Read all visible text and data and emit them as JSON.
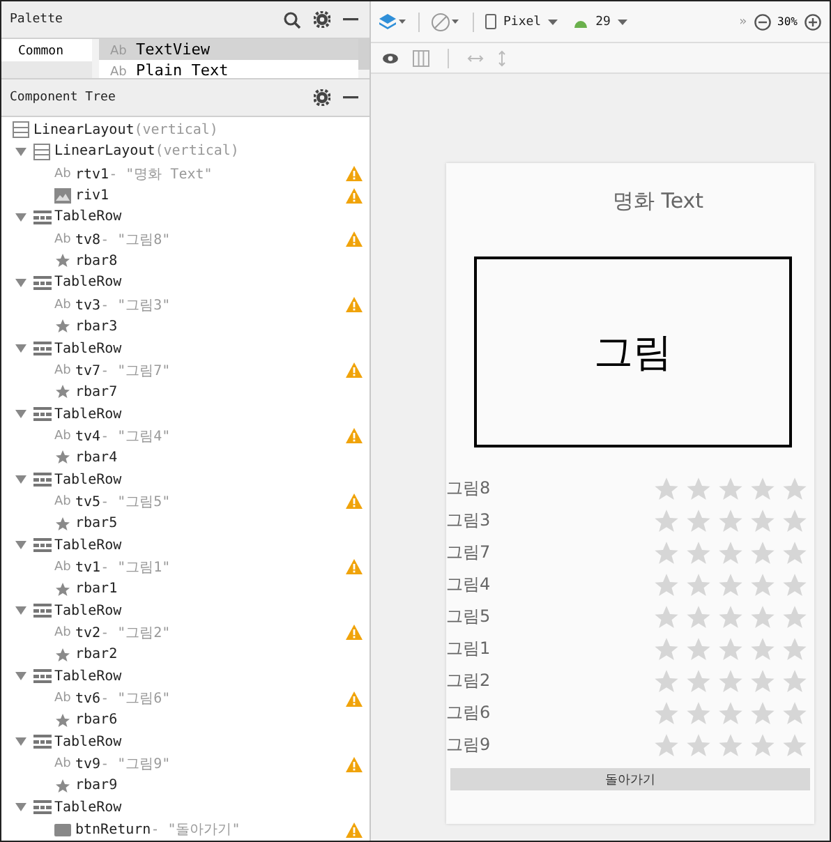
{
  "palette": {
    "title": "Palette",
    "categories": [
      {
        "label": "Common",
        "selected": true
      }
    ],
    "items": [
      {
        "badge": "Ab",
        "label": "TextView",
        "selected": true
      },
      {
        "badge": "Ab",
        "label": "Plain Text",
        "selected": false
      }
    ]
  },
  "component_tree": {
    "title": "Component Tree",
    "nodes": [
      {
        "kind": "linear",
        "name": "LinearLayout",
        "detail": "(vertical)",
        "warning": false,
        "children": [
          {
            "kind": "linear",
            "name": "LinearLayout",
            "detail": "(vertical)",
            "expanded": true,
            "warning": false,
            "children": [
              {
                "kind": "text",
                "badge": "Ab",
                "name": "rtv1",
                "detail": "- \"명화 Text\"",
                "warning": true
              },
              {
                "kind": "image",
                "name": "riv1",
                "warning": true
              }
            ]
          },
          {
            "kind": "row",
            "name": "TableRow",
            "expanded": true,
            "warning": false,
            "children": [
              {
                "kind": "text",
                "badge": "Ab",
                "name": "tv8",
                "detail": "- \"그림8\"",
                "warning": true
              },
              {
                "kind": "rating",
                "name": "rbar8",
                "warning": false
              }
            ]
          },
          {
            "kind": "row",
            "name": "TableRow",
            "expanded": true,
            "warning": false,
            "children": [
              {
                "kind": "text",
                "badge": "Ab",
                "name": "tv3",
                "detail": "- \"그림3\"",
                "warning": true
              },
              {
                "kind": "rating",
                "name": "rbar3",
                "warning": false
              }
            ]
          },
          {
            "kind": "row",
            "name": "TableRow",
            "expanded": true,
            "warning": false,
            "children": [
              {
                "kind": "text",
                "badge": "Ab",
                "name": "tv7",
                "detail": "- \"그림7\"",
                "warning": true
              },
              {
                "kind": "rating",
                "name": "rbar7",
                "warning": false
              }
            ]
          },
          {
            "kind": "row",
            "name": "TableRow",
            "expanded": true,
            "warning": false,
            "children": [
              {
                "kind": "text",
                "badge": "Ab",
                "name": "tv4",
                "detail": "- \"그림4\"",
                "warning": true
              },
              {
                "kind": "rating",
                "name": "rbar4",
                "warning": false
              }
            ]
          },
          {
            "kind": "row",
            "name": "TableRow",
            "expanded": true,
            "warning": false,
            "children": [
              {
                "kind": "text",
                "badge": "Ab",
                "name": "tv5",
                "detail": "- \"그림5\"",
                "warning": true
              },
              {
                "kind": "rating",
                "name": "rbar5",
                "warning": false
              }
            ]
          },
          {
            "kind": "row",
            "name": "TableRow",
            "expanded": true,
            "warning": false,
            "children": [
              {
                "kind": "text",
                "badge": "Ab",
                "name": "tv1",
                "detail": "- \"그림1\"",
                "warning": true
              },
              {
                "kind": "rating",
                "name": "rbar1",
                "warning": false
              }
            ]
          },
          {
            "kind": "row",
            "name": "TableRow",
            "expanded": true,
            "warning": false,
            "children": [
              {
                "kind": "text",
                "badge": "Ab",
                "name": "tv2",
                "detail": "- \"그림2\"",
                "warning": true
              },
              {
                "kind": "rating",
                "name": "rbar2",
                "warning": false
              }
            ]
          },
          {
            "kind": "row",
            "name": "TableRow",
            "expanded": true,
            "warning": false,
            "children": [
              {
                "kind": "text",
                "badge": "Ab",
                "name": "tv6",
                "detail": "- \"그림6\"",
                "warning": true
              },
              {
                "kind": "rating",
                "name": "rbar6",
                "warning": false
              }
            ]
          },
          {
            "kind": "row",
            "name": "TableRow",
            "expanded": true,
            "warning": false,
            "children": [
              {
                "kind": "text",
                "badge": "Ab",
                "name": "tv9",
                "detail": "- \"그림9\"",
                "warning": true
              },
              {
                "kind": "rating",
                "name": "rbar9",
                "warning": false
              }
            ]
          },
          {
            "kind": "row",
            "name": "TableRow",
            "expanded": true,
            "warning": false,
            "children": [
              {
                "kind": "button",
                "name": "btnReturn",
                "detail": "- \"돌아가기\"",
                "warning": true
              }
            ]
          }
        ]
      }
    ]
  },
  "toolbar": {
    "device": "Pixel",
    "api": "29",
    "overflow": "»",
    "zoom": "30%"
  },
  "preview": {
    "title": "명화 Text",
    "image_label": "그림",
    "ratings": [
      {
        "label": "그림8",
        "stars": 0
      },
      {
        "label": "그림3",
        "stars": 0
      },
      {
        "label": "그림7",
        "stars": 0
      },
      {
        "label": "그림4",
        "stars": 0
      },
      {
        "label": "그림5",
        "stars": 0
      },
      {
        "label": "그림1",
        "stars": 0
      },
      {
        "label": "그림2",
        "stars": 0
      },
      {
        "label": "그림6",
        "stars": 0
      },
      {
        "label": "그림9",
        "stars": 0
      }
    ],
    "button": "돌아가기"
  }
}
